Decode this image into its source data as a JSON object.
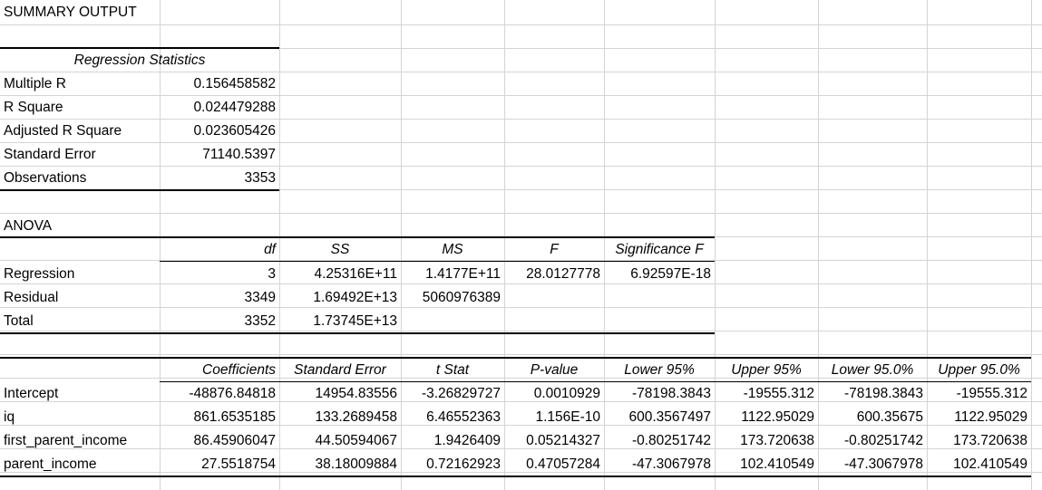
{
  "title": "SUMMARY OUTPUT",
  "regression_statistics": {
    "header": "Regression Statistics",
    "rows": [
      {
        "label": "Multiple R",
        "value": "0.156458582"
      },
      {
        "label": "R Square",
        "value": "0.024479288"
      },
      {
        "label": "Adjusted R Square",
        "value": "0.023605426"
      },
      {
        "label": "Standard Error",
        "value": "71140.5397"
      },
      {
        "label": "Observations",
        "value": "3353"
      }
    ]
  },
  "anova": {
    "title": "ANOVA",
    "headers": [
      "df",
      "SS",
      "MS",
      "F",
      "Significance F"
    ],
    "rows": [
      {
        "label": "Regression",
        "cells": [
          "3",
          "4.25316E+11",
          "1.4177E+11",
          "28.0127778",
          "6.92597E-18"
        ]
      },
      {
        "label": "Residual",
        "cells": [
          "3349",
          "1.69492E+13",
          "5060976389",
          "",
          ""
        ]
      },
      {
        "label": "Total",
        "cells": [
          "3352",
          "1.73745E+13",
          "",
          "",
          ""
        ]
      }
    ]
  },
  "coefficients": {
    "headers": [
      "Coefficients",
      "Standard Error",
      "t Stat",
      "P-value",
      "Lower 95%",
      "Upper 95%",
      "Lower 95.0%",
      "Upper 95.0%"
    ],
    "rows": [
      {
        "label": "Intercept",
        "cells": [
          "-48876.84818",
          "14954.83556",
          "-3.26829727",
          "0.0010929",
          "-78198.3843",
          "-19555.312",
          "-78198.3843",
          "-19555.312"
        ]
      },
      {
        "label": "iq",
        "cells": [
          "861.6535185",
          "133.2689458",
          "6.46552363",
          "1.156E-10",
          "600.3567497",
          "1122.95029",
          "600.35675",
          "1122.95029"
        ]
      },
      {
        "label": "first_parent_income",
        "cells": [
          "86.45906047",
          "44.50594067",
          "1.9426409",
          "0.05214327",
          "-0.80251742",
          "173.720638",
          "-0.80251742",
          "173.720638"
        ]
      },
      {
        "label": "parent_income",
        "cells": [
          "27.5518754",
          "38.18009884",
          "0.72162923",
          "0.47057284",
          "-47.3067978",
          "102.410549",
          "-47.3067978",
          "102.410549"
        ]
      }
    ]
  }
}
